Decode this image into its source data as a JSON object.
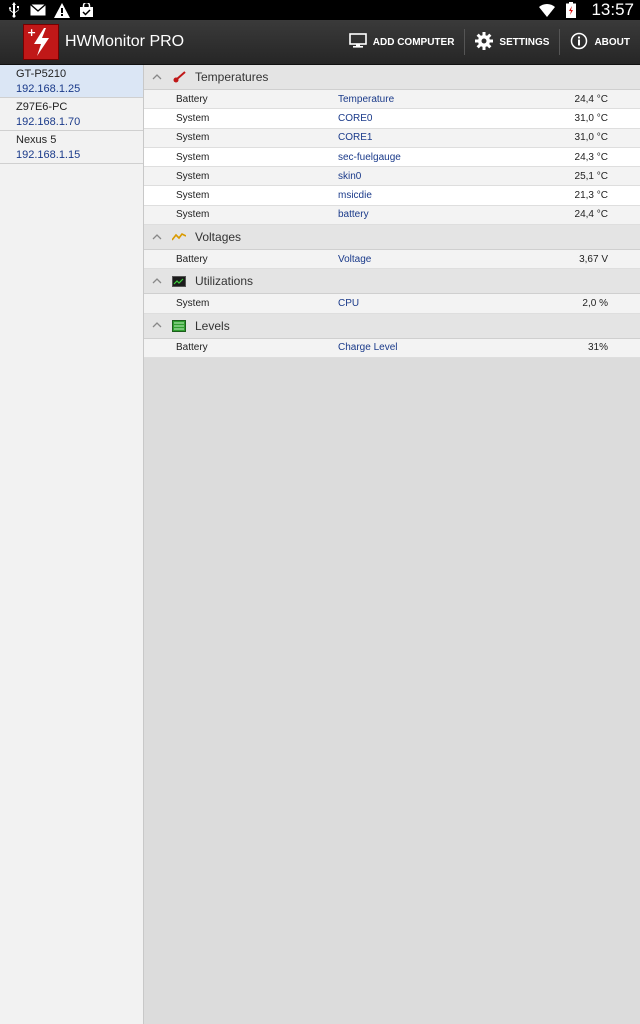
{
  "statusbar": {
    "time": "13:57"
  },
  "app": {
    "title": "HWMonitor PRO"
  },
  "actions": {
    "add_computer": "ADD COMPUTER",
    "settings": "SETTINGS",
    "about": "ABOUT"
  },
  "devices": [
    {
      "name": "GT-P5210",
      "ip": "192.168.1.25"
    },
    {
      "name": "Z97E6-PC",
      "ip": "192.168.1.70"
    },
    {
      "name": "Nexus 5",
      "ip": "192.168.1.15"
    }
  ],
  "sections": {
    "temperatures": {
      "title": "Temperatures",
      "rows": [
        {
          "source": "Battery",
          "sensor": "Temperature",
          "value": "24,4 °C"
        },
        {
          "source": "System",
          "sensor": "CORE0",
          "value": "31,0 °C"
        },
        {
          "source": "System",
          "sensor": "CORE1",
          "value": "31,0 °C"
        },
        {
          "source": "System",
          "sensor": "sec-fuelgauge",
          "value": "24,3 °C"
        },
        {
          "source": "System",
          "sensor": "skin0",
          "value": "25,1 °C"
        },
        {
          "source": "System",
          "sensor": "msicdie",
          "value": "21,3 °C"
        },
        {
          "source": "System",
          "sensor": "battery",
          "value": "24,4 °C"
        }
      ]
    },
    "voltages": {
      "title": "Voltages",
      "rows": [
        {
          "source": "Battery",
          "sensor": "Voltage",
          "value": "3,67 V"
        }
      ]
    },
    "utilizations": {
      "title": "Utilizations",
      "rows": [
        {
          "source": "System",
          "sensor": "CPU",
          "value": "2,0 %"
        }
      ]
    },
    "levels": {
      "title": "Levels",
      "rows": [
        {
          "source": "Battery",
          "sensor": "Charge Level",
          "value": "31%"
        }
      ]
    }
  },
  "icons": {
    "usb": "usb-icon",
    "mail": "mail-icon",
    "warning": "warning-icon",
    "bag": "shopping-bag-icon",
    "wifi": "wifi-icon",
    "battery": "battery-low-icon",
    "monitor": "monitor-icon",
    "gear": "gear-icon",
    "info": "info-icon"
  },
  "colors": {
    "accent_red": "#c01818",
    "link_blue": "#1a3a8a",
    "selected_bg": "#dbe6f5"
  }
}
